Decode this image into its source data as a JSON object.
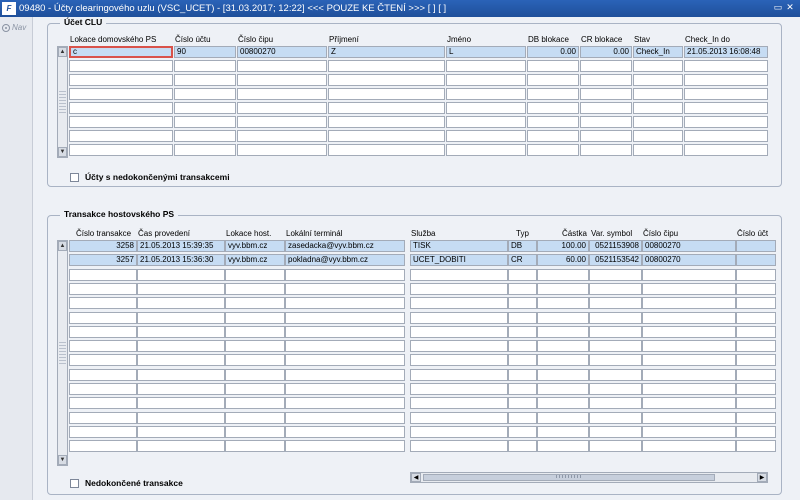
{
  "window": {
    "app_icon_text": "F",
    "title": "09480 - Účty clearingového uzlu (VSC_UCET) - [31.03.2017; 12:22] <<< POUZE KE ČTENÍ >>>  [ ] [ ]",
    "controls": [
      "▭",
      "✕"
    ]
  },
  "sidebar": {
    "nav_label": "Nav"
  },
  "ucet_clu": {
    "label": "Účet CLU",
    "columns": [
      "Lokace domovského PS",
      "Číslo účtu",
      "Číslo čipu",
      "Příjmení",
      "Jméno",
      "DB blokace",
      "CR blokace",
      "Stav",
      "Check_In do"
    ],
    "rows": [
      [
        "c",
        "90",
        "00800270",
        "Z",
        "L",
        "0.00",
        "0.00",
        "Check_In",
        "21.05.2013 16:08:48"
      ]
    ],
    "row_count": 8
  },
  "checkbox_nedokoncene_ucty": {
    "label": "Účty s nedokončenými transakcemi"
  },
  "transakce": {
    "label": "Transakce hostovského PS",
    "left_columns": [
      "Číslo transakce",
      "Čas provedení",
      "Lokace host.",
      "Lokální terminál"
    ],
    "left_rows": [
      [
        "3258",
        "21.05.2013 15:39:35",
        "vyv.bbm.cz",
        "zasedacka@vyv.bbm.cz"
      ],
      [
        "3257",
        "21.05.2013 15:36:30",
        "vyv.bbm.cz",
        "pokladna@vyv.bbm.cz"
      ]
    ],
    "right_columns": [
      "Služba",
      "Typ",
      "Částka",
      "Var. symbol",
      "Číslo čipu",
      "Číslo účt"
    ],
    "right_rows": [
      [
        "TISK",
        "DB",
        "100.00",
        "0521153908",
        "00800270",
        ""
      ],
      [
        "UCET_DOBITI",
        "CR",
        "60.00",
        "0521153542",
        "00800270",
        ""
      ]
    ],
    "row_count": 15
  },
  "checkbox_nedokoncene_transakce": {
    "label": "Nedokončené transakce"
  }
}
